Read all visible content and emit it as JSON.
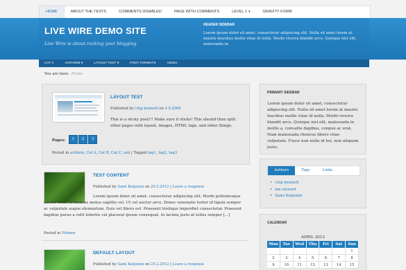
{
  "topnav": {
    "items": [
      {
        "label": "HOME"
      },
      {
        "label": "ABOUT THE TESTS"
      },
      {
        "label": "COMMENTS DISABLED"
      },
      {
        "label": "PAGE WITH COMMENTS"
      },
      {
        "label": "LEVEL 1"
      },
      {
        "label": "GRAVITY FORM"
      }
    ]
  },
  "header": {
    "site_title": "LIVE WIRE DEMO SITE",
    "tagline": "Live Wire is about rocking your blogging",
    "sidebar_title": "HEADER SIDEBAR",
    "sidebar_text": "Lorem ipsum dolor sit amet, consectetur adipiscing elit. Nulla sit amet lorem at mauris faucibus mollis vitae id nulla. Morbi viverra blandit arcu. Quisque nisl elit, malesuada in."
  },
  "subnav": {
    "items": [
      {
        "label": "CAT A"
      },
      {
        "label": "ACIFORM"
      },
      {
        "label": "LAYOUT TEST"
      },
      {
        "label": "POST FORMATS"
      },
      {
        "label": "VIDEO"
      }
    ]
  },
  "breadcrumb": {
    "prefix": "You are here:",
    "current": "Home"
  },
  "posts": [
    {
      "title": "LAYOUT TEST",
      "meta_prefix": "Published by",
      "author": "chip bennett",
      "meta_on": "on",
      "date": "4.9.2008",
      "excerpt": "This is a sticky post!!! Make sure it sticks! This should then split other pages with layout, images, HTML tags, and other things.",
      "pages_label": "Pages:",
      "pages": [
        "1",
        "2",
        "3"
      ],
      "posted_prefix": "Posted in",
      "categories": "aciform, Cat A, Cat B, Cat C, sub",
      "tagged_prefix": "| Tagged",
      "tags": "tag1, tag2, tag3"
    },
    {
      "title": "TEST CONTENT",
      "meta_prefix": "Published by",
      "author": "Sami Keijonen",
      "meta_on": "on",
      "date": "29.2.2012",
      "sep": "|",
      "response": "Leave a response",
      "excerpt": "Lorem ipsum dolor sit amet, consectetur adipiscing elit. Morbi pellentesque auctor risus, a rhoncus metus sagittis vel. Ut vel auctor arcu. Donec venenatis tortor id ligula semper ac vulputate augue elementum. Duis vel libero est. Praesent tristique imperdiet consectetur. Praesent dapibus purus a velit lobortis vel placerat ipsum consequat. In lacinia justo at tellus semper [...]",
      "posted_prefix": "Posted in",
      "categories": "Yleinen"
    },
    {
      "title": "DEFAULT LAYOUT",
      "meta_prefix": "Published by",
      "author": "Sami Keijonen",
      "meta_on": "on",
      "date": "25.2.2012",
      "sep": "|",
      "response": "Leave a response"
    }
  ],
  "sidebar": {
    "primary_title": "PRIMARY SIDEBAR",
    "primary_text": "Lorem ipsum dolor sit amet, consectetur adipiscing elit. Nulla sit amet lorem at mauris faucibus mollis vitae id nulla. Morbi viverra blandit arcu. Quisque nisl elit, malesuada in mollis a, convallis dapibus, congue ac erat. Nam malesuada rhoncus libero vitae vulputate. Fusce non nulla id leo, non aliquam justo.",
    "tabs": [
      "Authors",
      "Tags",
      "Links"
    ],
    "authors": [
      "chip bennett",
      "ian stewart",
      "Sami Keijonen"
    ],
    "calendar_title": "CALENDAR",
    "calendar_month": "APRIL 2012",
    "weekdays": [
      "Mon",
      "Tue",
      "Wed",
      "Thu",
      "Fri",
      "Sat",
      "Sun"
    ],
    "weeks": [
      [
        "",
        "",
        "",
        "",
        "",
        "",
        "1"
      ],
      [
        "2",
        "3",
        "4",
        "5",
        "6",
        "7",
        "8"
      ],
      [
        "9",
        "10",
        "11",
        "12",
        "13",
        "14",
        "15"
      ]
    ]
  },
  "colors": {
    "accent": "#1f7bbd",
    "header": "#2b88c9",
    "subnav": "#1a5f96",
    "background": "#f2f2f2"
  }
}
